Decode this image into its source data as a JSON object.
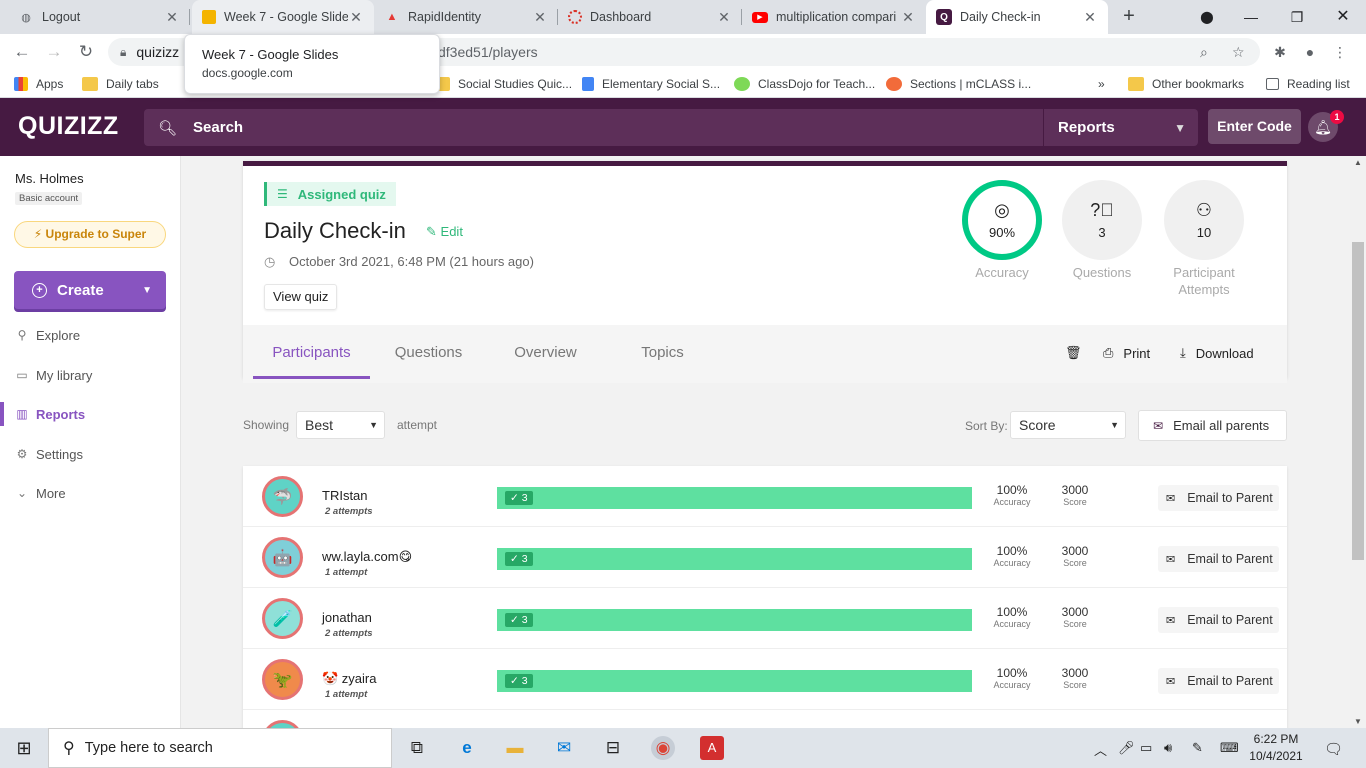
{
  "browser": {
    "tabs": [
      {
        "title": "Logout",
        "favicon": "globe-icon"
      },
      {
        "title": "Week 7 - Google Slide",
        "favicon": "google-slides-icon"
      },
      {
        "title": "RapidIdentity",
        "favicon": "rapididentity-icon"
      },
      {
        "title": "Dashboard",
        "favicon": "dashboard-icon"
      },
      {
        "title": "multiplication compari",
        "favicon": "youtube-icon"
      },
      {
        "title": "Daily Check-in",
        "favicon": "quizizz-icon"
      }
    ],
    "url_prefix": "quizizz",
    "url_tail": "df3ed51/players",
    "tooltip": {
      "title": "Week 7 - Google Slides",
      "domain": "docs.google.com"
    },
    "bookmarks": [
      {
        "label": "Apps"
      },
      {
        "label": "Daily tabs"
      },
      {
        "label": "Social Studies Quic..."
      },
      {
        "label": "Elementary Social S..."
      },
      {
        "label": "ClassDojo for Teach..."
      },
      {
        "label": "Sections | mCLASS i..."
      },
      {
        "label": "»"
      },
      {
        "label": "Other bookmarks"
      },
      {
        "label": "Reading list"
      }
    ]
  },
  "header": {
    "logo": "QUIZIZZ",
    "search_label": "Search",
    "reports_label": "Reports",
    "enter_code_label": "Enter Code",
    "notification_count": "1"
  },
  "sidebar": {
    "user_name": "Ms. Holmes",
    "account_type": "Basic account",
    "upgrade_label": "Upgrade to Super",
    "create_label": "Create",
    "items": [
      {
        "label": "Explore",
        "icon": "explore-icon"
      },
      {
        "label": "My library",
        "icon": "folder-icon"
      },
      {
        "label": "Reports",
        "icon": "reports-icon",
        "active": true
      },
      {
        "label": "Settings",
        "icon": "gear-icon"
      },
      {
        "label": "More",
        "icon": "chevron-down-icon"
      }
    ]
  },
  "quiz": {
    "tag": "Assigned quiz",
    "title": "Daily Check-in",
    "edit_label": "Edit",
    "date": "October 3rd 2021, 6:48 PM (21 hours ago)",
    "view_quiz_label": "View quiz",
    "stats": [
      {
        "value": "90%",
        "label": "Accuracy"
      },
      {
        "value": "3",
        "label": "Questions"
      },
      {
        "value": "10",
        "label": "Participant Attempts"
      }
    ],
    "accuracy_fraction": 0.9
  },
  "report_tabs": [
    "Participants",
    "Questions",
    "Overview",
    "Topics"
  ],
  "actions": {
    "print": "Print",
    "download": "Download"
  },
  "filters": {
    "showing_label": "Showing",
    "showing_value": "Best",
    "attempt_label": "attempt",
    "sortby_label": "Sort By:",
    "sortby_value": "Score",
    "email_all_label": "Email all parents"
  },
  "participants": [
    {
      "name": "TRIstan",
      "attempts": "2 attempts",
      "correct": "✓ 3",
      "accuracy": "100%",
      "accuracy_label": "Accuracy",
      "score": "3000",
      "score_label": "Score",
      "email_label": "Email to Parent"
    },
    {
      "name": "ww.layla.com😋",
      "attempts": "1 attempt",
      "correct": "✓ 3",
      "accuracy": "100%",
      "accuracy_label": "Accuracy",
      "score": "3000",
      "score_label": "Score",
      "email_label": "Email to Parent"
    },
    {
      "name": "jonathan",
      "attempts": "2 attempts",
      "correct": "✓ 3",
      "accuracy": "100%",
      "accuracy_label": "Accuracy",
      "score": "3000",
      "score_label": "Score",
      "email_label": "Email to Parent"
    },
    {
      "name": "🤡 zyaira",
      "attempts": "1 attempt",
      "correct": "✓ 3",
      "accuracy": "100%",
      "accuracy_label": "Accuracy",
      "score": "3000",
      "score_label": "Score",
      "email_label": "Email to Parent"
    }
  ],
  "taskbar": {
    "search_placeholder": "Type here to search",
    "time": "6:22 PM",
    "date": "10/4/2021"
  },
  "colors": {
    "brand": "#461a42",
    "accent": "#8854c0",
    "correct": "#5ee0a0",
    "accuracy_ring": "#00c985"
  }
}
